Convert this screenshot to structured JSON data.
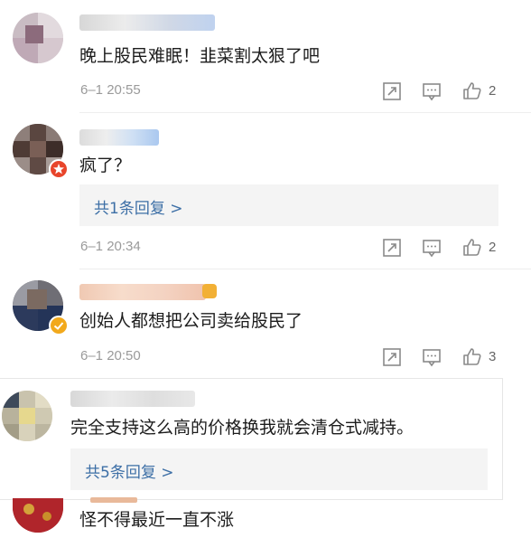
{
  "comments": [
    {
      "text": "晚上股民难眠！韭菜割太狠了吧",
      "time": "6–1 20:55",
      "likes": "2"
    },
    {
      "text": "疯了？",
      "time": "6–1 20:34",
      "likes": "2",
      "reply": "共1条回复 >"
    },
    {
      "text": "创始人都想把公司卖给股民了",
      "time": "6–1 20:50",
      "likes": "3"
    },
    {
      "text": "完全支持这么高的价格换我就会清仓式减持。",
      "reply": "共5条回复 >"
    },
    {
      "text": "怪不得最近一直不涨"
    }
  ],
  "icons": {
    "repost": "repost-icon",
    "comment": "comment-icon",
    "like": "thumbs-up-icon"
  },
  "colors": {
    "reply_link": "#3d6fa6",
    "timestamp": "#9a9a9a",
    "reply_bg": "#f4f4f4"
  }
}
